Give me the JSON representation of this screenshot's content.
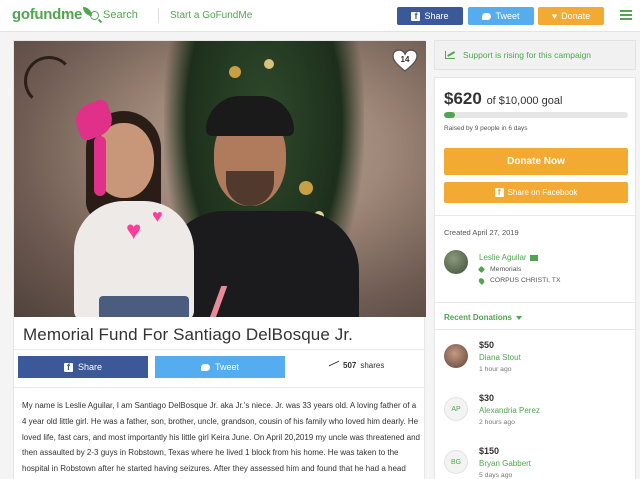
{
  "header": {
    "logo_text": "gofundme",
    "search_label": "Search",
    "start_label": "Start a GoFundMe",
    "share_label": "Share",
    "tweet_label": "Tweet",
    "donate_label": "Donate"
  },
  "campaign": {
    "hearts_count": "14",
    "title": "Memorial Fund For Santiago DelBosque Jr.",
    "share_label": "Share",
    "tweet_label": "Tweet",
    "shares_count": "507",
    "shares_suffix": "shares",
    "story": "My name is Leslie Aguilar, I am Santiago DelBosque Jr. aka Jr.'s niece. Jr. was 33 years old. A loving father of a 4 year old little girl. He was a father, son, brother, uncle, grandson, cousin of his family who loved him dearly. He loved life, fast cars, and most importantly his little girl Keira June. On April 20,2019 my uncle was threatened and then assaulted by 2-3 guys in Robstown, Texas where he lived 1 block from his home. He was taken to the hospital in Robstown after he started having seizures. After they assessed him and found that he had a head injury and his brain had bleeding and swelling they could not stabilize"
  },
  "sidebar": {
    "rising_text": "Support is rising for this campaign",
    "amount_raised": "$620",
    "goal_text": "of $10,000 goal",
    "progress_fraction": 0.062,
    "raised_by": "Raised by 9 people in 6 days",
    "donate_now": "Donate Now",
    "share_facebook": "Share on Facebook",
    "created": "Created April 27, 2019",
    "organizer": {
      "name": "Leslie Aguilar",
      "category": "Memorials",
      "location": "CORPUS CHRISTI, TX"
    },
    "recent_label": "Recent Donations",
    "donations": [
      {
        "amount": "$50",
        "name": "Diana Stout",
        "time": "1 hour ago",
        "initials": ""
      },
      {
        "amount": "$30",
        "name": "Alexandria Perez",
        "time": "2 hours ago",
        "initials": "AP"
      },
      {
        "amount": "$150",
        "name": "Bryan Gabbert",
        "time": "5 days ago",
        "initials": "BG"
      }
    ]
  },
  "colors": {
    "brand_green": "#53a451",
    "facebook_blue": "#3b5998",
    "twitter_blue": "#55acee",
    "donate_orange": "#f3aa32"
  },
  "icons": [
    "search-icon",
    "facebook-icon",
    "twitter-icon",
    "heart-icon",
    "menu-icon",
    "trending-icon",
    "mail-icon",
    "tag-icon",
    "location-pin-icon",
    "caret-down-icon"
  ]
}
